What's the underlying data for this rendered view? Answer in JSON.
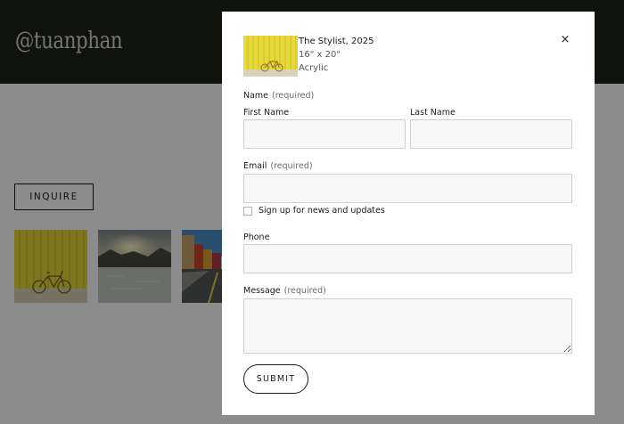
{
  "site": {
    "logo": "@tuanphan",
    "inquire_label": "INQUIRE",
    "thumbnails": [
      "yellow-bicycle",
      "sunset-lake",
      "colorful-street"
    ]
  },
  "modal": {
    "close_icon": "×",
    "product": {
      "title": "The Stylist, 2025",
      "size": "16\" x 20\"",
      "medium": "Acrylic"
    },
    "form": {
      "name_label": "Name",
      "name_required": "(required)",
      "first_name_label": "First Name",
      "first_name_value": "",
      "last_name_label": "Last Name",
      "last_name_value": "",
      "email_label": "Email",
      "email_required": "(required)",
      "email_value": "",
      "newsletter_label": "Sign up for news and updates",
      "newsletter_checked": false,
      "phone_label": "Phone",
      "phone_value": "",
      "message_label": "Message",
      "message_required": "(required)",
      "message_value": "",
      "submit_label": "SUBMIT"
    }
  },
  "colors": {
    "header_bg": "#1d2414",
    "field_bg": "#f7f7f8",
    "overlay": "rgba(0,0,0,0.45)"
  }
}
